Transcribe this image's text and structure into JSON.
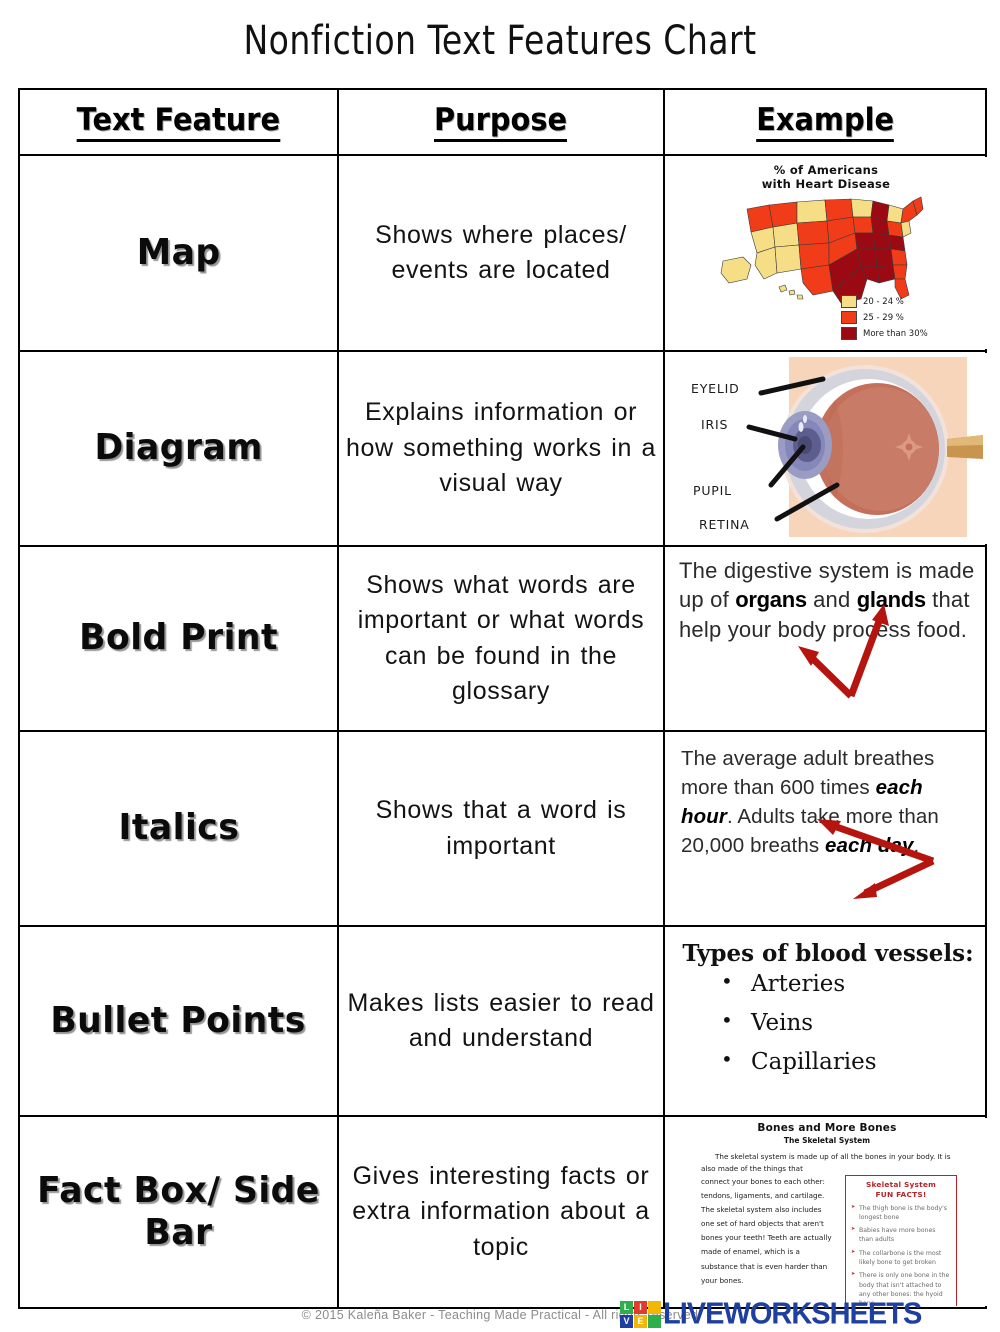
{
  "title": "Nonfiction Text Features Chart",
  "table": {
    "headers": [
      "Text Feature",
      "Purpose",
      "Example"
    ],
    "rows": [
      {
        "feature": "Map",
        "purpose": "Shows where places/ events are located",
        "example_type": "map-image"
      },
      {
        "feature": "Diagram",
        "purpose": "Explains information or how something works in a visual way",
        "example_type": "eye-diagram-image"
      },
      {
        "feature": "Bold Print",
        "purpose": "Shows what words are important or what words can be found in the glossary",
        "example_type": "bold-text-sample"
      },
      {
        "feature": "Italics",
        "purpose": "Shows that a word is important",
        "example_type": "italic-text-sample"
      },
      {
        "feature": "Bullet Points",
        "purpose": "Makes lists easier to read and understand",
        "example_type": "bullet-list-sample"
      },
      {
        "feature": "Fact Box/ Side Bar",
        "purpose": "Gives interesting facts or extra information about a topic",
        "example_type": "fact-box-sample"
      }
    ]
  },
  "map_example": {
    "title_line1": "% of Americans",
    "title_line2": "with Heart Disease",
    "legend": [
      {
        "label": "20 - 24 %",
        "color": "#F5DE85"
      },
      {
        "label": "25 - 29 %",
        "color": "#F03C18"
      },
      {
        "label": "More than 30%",
        "color": "#9B0A12"
      }
    ]
  },
  "eye_example": {
    "labels": [
      "EYELID",
      "IRIS",
      "PUPIL",
      "RETINA"
    ]
  },
  "bold_example": {
    "p1": "The digestive system is made up of ",
    "b1": "organs",
    "p2": " and ",
    "b2": "glands",
    "p3": " that help your body process food.",
    "arrow_color": "#B5140F"
  },
  "italic_example": {
    "p1": "The average adult breathes more than 600 times ",
    "i1": "each hour",
    "p2": ". Adults take more than 20,000 breaths ",
    "i2": "each day",
    "p3": ".",
    "arrow_color": "#B5140F"
  },
  "bullet_example": {
    "heading": "Types of blood vessels:",
    "items": [
      "Arteries",
      "Veins",
      "Capillaries"
    ]
  },
  "factbox_example": {
    "title": "Bones and More Bones",
    "subtitle": "The Skeletal System",
    "intro": "The skeletal system is made up of all the bones in your body.  It is also made of the things that",
    "body": "connect your bones to each other: tendons, ligaments, and cartilage. The skeletal system also includes one set of hard objects that aren't bones your teeth!  Teeth are actually made of enamel, which is a substance that is even harder than your bones.",
    "sidebar_title_line1": "Skeletal System",
    "sidebar_title_line2": "FUN FACTS!",
    "sidebar_facts": [
      "The thigh bone is the body's longest bone",
      "Babies have more bones than adults",
      "The collarbone is the most likely bone to get broken",
      "There is only one bone in the body that isn't attached to any other bones: the hyoid bone"
    ],
    "sidebar_color": "#B3252B"
  },
  "footer": {
    "copyright": "© 2015 Kaleña Baker - Teaching Made Practical - All rights reserved",
    "watermark_word": "LIVEWORKSHEETS",
    "watermark_tiles": [
      "L",
      "I",
      "V",
      "E"
    ],
    "watermark_color": "#1D3FA0"
  }
}
